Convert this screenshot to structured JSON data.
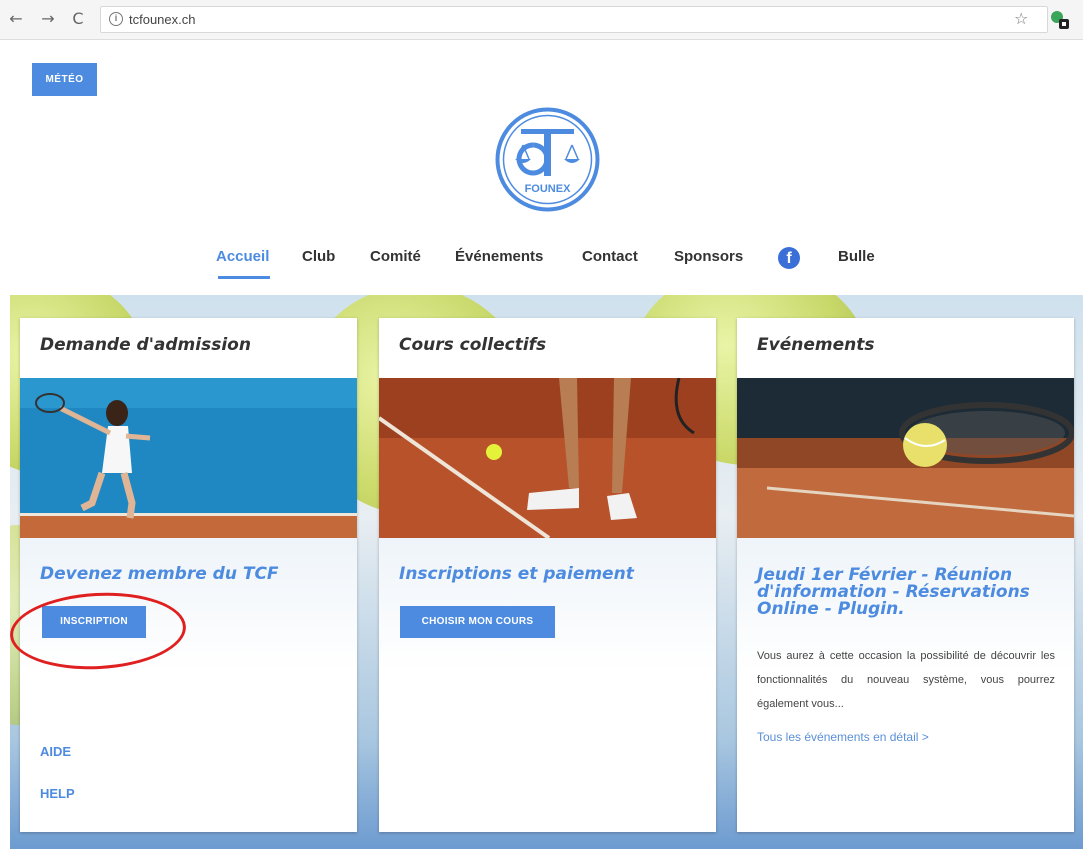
{
  "browser": {
    "back": "←",
    "forward": "→",
    "reload": "C",
    "info": "i",
    "url": "tcfounex.ch",
    "star": "☆"
  },
  "header": {
    "meteo_label": "MÉTÉO",
    "logo_text": "FOUNEX"
  },
  "nav": {
    "items": [
      {
        "label": "Accueil"
      },
      {
        "label": "Club"
      },
      {
        "label": "Comité"
      },
      {
        "label": "Événements"
      },
      {
        "label": "Contact"
      },
      {
        "label": "Sponsors"
      },
      {
        "label": "Bulle"
      }
    ],
    "facebook_glyph": "f",
    "active_color": "#4d8be0"
  },
  "cards": [
    {
      "title": "Demande d'admission",
      "subtitle": "Devenez membre du TCF",
      "button": "INSCRIPTION",
      "links": [
        "AIDE",
        "HELP"
      ]
    },
    {
      "title": "Cours collectifs",
      "subtitle": "Inscriptions et paiement",
      "button": "CHOISIR MON COURS"
    },
    {
      "title": "Evénements",
      "subtitle_lines": [
        "Jeudi 1er Février - Réunion",
        "d'information - Réservations",
        "Online - Plugin."
      ],
      "text": "Vous aurez à cette occasion la possibilité de découvrir les fonctionnalités du nouveau système, vous pourrez également vous...",
      "link": "Tous les événements en détail >"
    }
  ],
  "colors": {
    "accent": "#4d8be0",
    "annotation": "#e02020"
  }
}
